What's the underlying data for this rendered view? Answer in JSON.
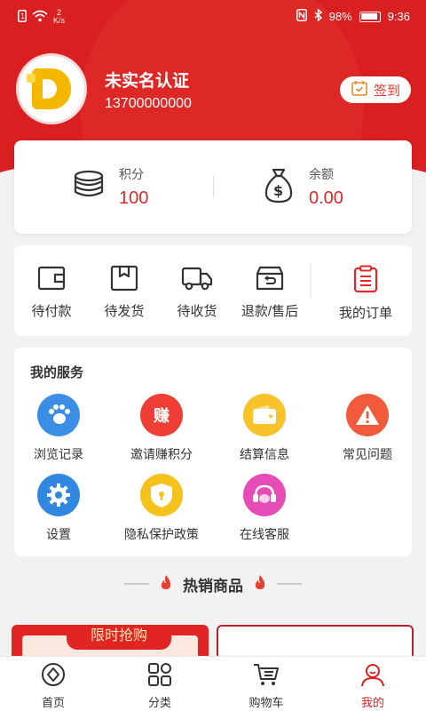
{
  "status_bar": {
    "network_speed_value": "2",
    "network_speed_unit": "K/s",
    "battery": "98%",
    "time": "9:36"
  },
  "profile": {
    "name": "未实名认证",
    "phone": "13700000000",
    "signin_label": "签到"
  },
  "wallet": {
    "points_label": "积分",
    "points_value": "100",
    "balance_label": "余额",
    "balance_value": "0.00"
  },
  "orders": {
    "items": [
      {
        "label": "待付款",
        "icon": "wallet-icon"
      },
      {
        "label": "待发货",
        "icon": "box-icon"
      },
      {
        "label": "待收货",
        "icon": "truck-icon"
      },
      {
        "label": "退款/售后",
        "icon": "return-box-icon"
      }
    ],
    "my_orders_label": "我的订单"
  },
  "services": {
    "title": "我的服务",
    "items": [
      {
        "label": "浏览记录",
        "icon": "footprint-icon",
        "color": "#3a8ee6"
      },
      {
        "label": "邀请赚积分",
        "icon": "earn-icon",
        "color": "#ef3e35",
        "glyph": "赚"
      },
      {
        "label": "结算信息",
        "icon": "wallet-icon",
        "color": "#f7c22a"
      },
      {
        "label": "常见问题",
        "icon": "warning-icon",
        "color": "#f15a3a"
      },
      {
        "label": "设置",
        "icon": "gear-icon",
        "color": "#2f87e0"
      },
      {
        "label": "隐私保护政策",
        "icon": "shield-lock-icon",
        "color": "#f5c21c"
      },
      {
        "label": "在线客服",
        "icon": "headset-icon",
        "color": "#e64cb5"
      }
    ]
  },
  "hot_section": {
    "title": "热销商品",
    "promo_label": "限时抢购"
  },
  "tabbar": {
    "items": [
      {
        "label": "首页",
        "icon": "home-icon"
      },
      {
        "label": "分类",
        "icon": "category-icon"
      },
      {
        "label": "购物车",
        "icon": "cart-icon"
      },
      {
        "label": "我的",
        "icon": "user-icon"
      }
    ],
    "active": "我的"
  },
  "colors": {
    "brand_red": "#d91f1f",
    "value_red": "#e0282a"
  }
}
